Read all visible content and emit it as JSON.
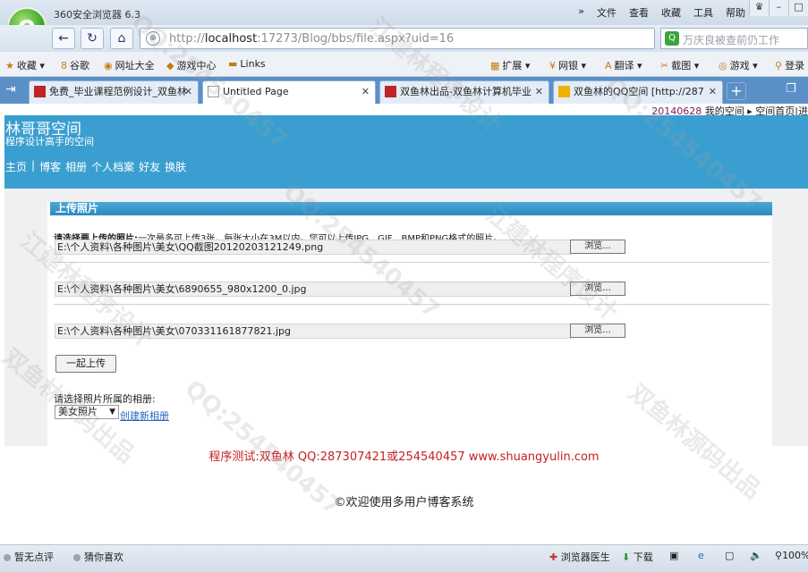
{
  "browser": {
    "app_title": "360安全浏览器 6.3",
    "menus": [
      "»",
      "文件",
      "查看",
      "收藏",
      "工具",
      "帮助"
    ],
    "url_prefix": "http://",
    "url_host": "localhost",
    "url_rest": ":17273/Blog/bbs/file.aspx?uid=16",
    "search_placeholder": "万庆良被查前仍工作",
    "favorites": [
      "收藏",
      "谷歌",
      "网址大全",
      "游戏中心",
      "Links"
    ],
    "tools": [
      "扩展",
      "网银",
      "翻译",
      "截图",
      "游戏",
      "登录"
    ],
    "tabs": [
      {
        "label": "免费_毕业课程范例设计_双鱼林",
        "active": false
      },
      {
        "label": "Untitled Page",
        "active": true
      },
      {
        "label": "双鱼林出品-双鱼林计算机毕业",
        "active": false
      },
      {
        "label": "双鱼林的QQ空间 [http://287",
        "active": false
      }
    ]
  },
  "page": {
    "date": "20140628",
    "my_space": "我的空间",
    "space_home": "空间首页",
    "site_title": "林哥哥空间",
    "site_subtitle": "程序设计高手的空间",
    "nav": [
      "主页",
      "博客",
      "相册",
      "个人档案",
      "好友",
      "换肤"
    ],
    "upload": {
      "title": "上传照片",
      "desc_bold": "请选择要上传的照片:",
      "desc": "一次最多可上传3张，每张大小在3M以内。您可以上传JPG、GIF、BMP和PNG格式的照片。",
      "files": [
        "E:\\个人资料\\各种图片\\美女\\QQ截图20120203121249.png",
        "E:\\个人资料\\各种图片\\美女\\6890655_980x1200_0.jpg",
        "E:\\个人资料\\各种图片\\美女\\070331161877821.jpg"
      ],
      "browse_label": "浏览...",
      "upload_button": "一起上传",
      "album_label": "请选择照片所属的相册:",
      "album_value": "美女照片",
      "new_album": "创建新相册"
    },
    "credit": "程序测试:双鱼林 QQ:287307421或254540457 www.shuangyulin.com",
    "copyright": "©欢迎使用多用户博客系统"
  },
  "status": {
    "left1": "暂无点评",
    "left2": "猜你喜欢",
    "doctor": "浏览器医生",
    "download": "下载",
    "zoom": "100%"
  },
  "watermark": {
    "line1": "QQ:254540457",
    "line2": "江建林程序设计",
    "line3": "双鱼林源码出品"
  }
}
